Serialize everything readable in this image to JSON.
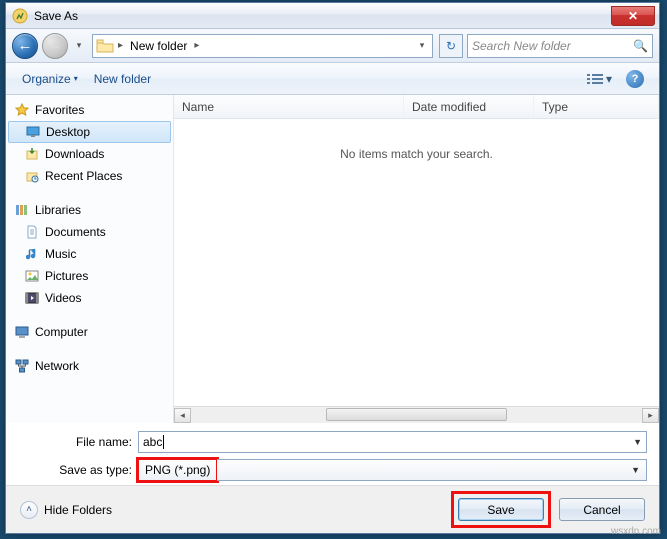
{
  "title": "Save As",
  "close_glyph": "✕",
  "nav": {
    "back_glyph": "←",
    "fwd_glyph": "→",
    "history_glyph": "▾",
    "refresh_glyph": "↻"
  },
  "breadcrumb": {
    "folder": "New folder",
    "arrow1": "▸",
    "arrow2": "▸",
    "drop": "▾"
  },
  "search": {
    "placeholder": "Search New folder",
    "icon": "🔍"
  },
  "toolbar": {
    "organize": "Organize",
    "newfolder": "New folder",
    "view_dd": "▾",
    "help": "?"
  },
  "sidebar": {
    "favorites": "Favorites",
    "desktop": "Desktop",
    "downloads": "Downloads",
    "recent": "Recent Places",
    "libraries": "Libraries",
    "documents": "Documents",
    "music": "Music",
    "pictures": "Pictures",
    "videos": "Videos",
    "computer": "Computer",
    "network": "Network"
  },
  "columns": {
    "name": "Name",
    "date": "Date modified",
    "type": "Type"
  },
  "empty_message": "No items match your search.",
  "form": {
    "filename_label": "File name:",
    "filename_value": "abc",
    "savetype_label": "Save as type:",
    "savetype_value": "PNG (*.png)"
  },
  "footer": {
    "hidefolders": "Hide Folders",
    "save": "Save",
    "cancel": "Cancel"
  },
  "watermark": "wsxdn.com"
}
